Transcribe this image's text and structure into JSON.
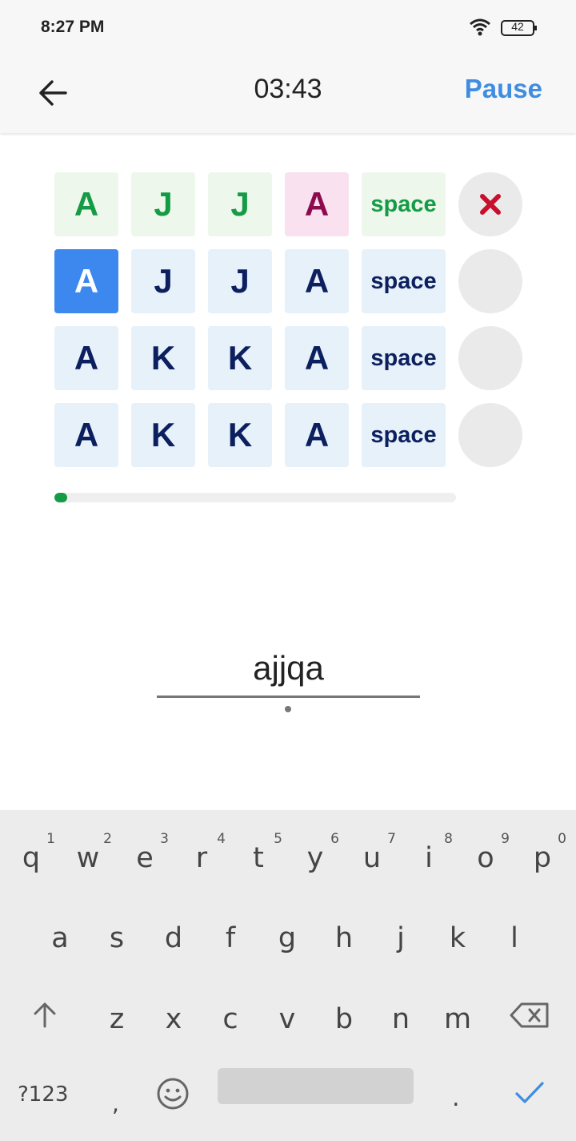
{
  "status": {
    "time": "8:27 PM",
    "battery": "42"
  },
  "header": {
    "timer": "03:43",
    "pause_label": "Pause"
  },
  "grid": {
    "rows": [
      {
        "cells": [
          "A",
          "J",
          "J",
          "A",
          "space"
        ],
        "states": [
          "ok",
          "ok",
          "ok",
          "bad",
          "ok"
        ],
        "result": "wrong"
      },
      {
        "cells": [
          "A",
          "J",
          "J",
          "A",
          "space"
        ],
        "states": [
          "active",
          "",
          "",
          "",
          ""
        ],
        "result": ""
      },
      {
        "cells": [
          "A",
          "K",
          "K",
          "A",
          "space"
        ],
        "states": [
          "",
          "",
          "",
          "",
          ""
        ],
        "result": ""
      },
      {
        "cells": [
          "A",
          "K",
          "K",
          "A",
          "space"
        ],
        "states": [
          "",
          "",
          "",
          "",
          ""
        ],
        "result": ""
      }
    ]
  },
  "progress": {
    "fraction": 0.03
  },
  "input": {
    "typed": "ajjqa"
  },
  "keyboard": {
    "row1": [
      {
        "letter": "q",
        "hint": "1"
      },
      {
        "letter": "w",
        "hint": "2"
      },
      {
        "letter": "e",
        "hint": "3"
      },
      {
        "letter": "r",
        "hint": "4"
      },
      {
        "letter": "t",
        "hint": "5"
      },
      {
        "letter": "y",
        "hint": "6"
      },
      {
        "letter": "u",
        "hint": "7"
      },
      {
        "letter": "i",
        "hint": "8"
      },
      {
        "letter": "o",
        "hint": "9"
      },
      {
        "letter": "p",
        "hint": "0"
      }
    ],
    "row2": [
      "a",
      "s",
      "d",
      "f",
      "g",
      "h",
      "j",
      "k",
      "l"
    ],
    "row3": [
      "z",
      "x",
      "c",
      "v",
      "b",
      "n",
      "m"
    ],
    "symbols_label": "?123",
    "comma": ",",
    "period": "."
  },
  "colors": {
    "accent": "#3f8de0",
    "correct": "#149b45",
    "wrong": "#c8102e"
  }
}
